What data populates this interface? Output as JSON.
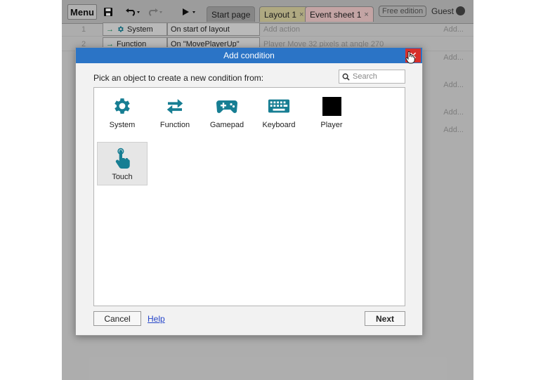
{
  "toolbar": {
    "menu_label": "Menu",
    "tabs": [
      {
        "label": "Start page",
        "close": ""
      },
      {
        "label": "Layout 1",
        "close": "×"
      },
      {
        "label": "Event sheet 1",
        "close": "×"
      }
    ],
    "free_edition_label": "Free edition",
    "guest_label": "Guest"
  },
  "events": [
    {
      "num": "1",
      "object": "System",
      "condition": "On start of layout",
      "action": "Add action",
      "add": "Add..."
    },
    {
      "num": "2",
      "object": "Function",
      "condition": "On \"MovePlayerUp\"",
      "action": "Player   Move 32 pixels at angle 270",
      "add": "Add..."
    }
  ],
  "side_add_labels": [
    "Add...",
    "Add...",
    "Add...",
    "Add..."
  ],
  "dialog": {
    "title": "Add condition",
    "close_glyph": "✕",
    "prompt": "Pick an object to create a new condition from:",
    "search_placeholder": "Search",
    "objects": [
      {
        "label": "System",
        "icon": "gear-icon"
      },
      {
        "label": "Function",
        "icon": "refresh-arrows-icon"
      },
      {
        "label": "Gamepad",
        "icon": "gamepad-icon"
      },
      {
        "label": "Keyboard",
        "icon": "keyboard-icon"
      },
      {
        "label": "Player",
        "icon": "black-square-sprite-icon"
      },
      {
        "label": "Touch",
        "icon": "touch-hand-icon",
        "selected": true
      }
    ],
    "cancel_label": "Cancel",
    "help_label": "Help",
    "next_label": "Next"
  },
  "colors": {
    "title_bar": "#2b74c6",
    "close_button": "#d7302b",
    "icon_teal": "#177e93",
    "link": "#2545c9"
  }
}
